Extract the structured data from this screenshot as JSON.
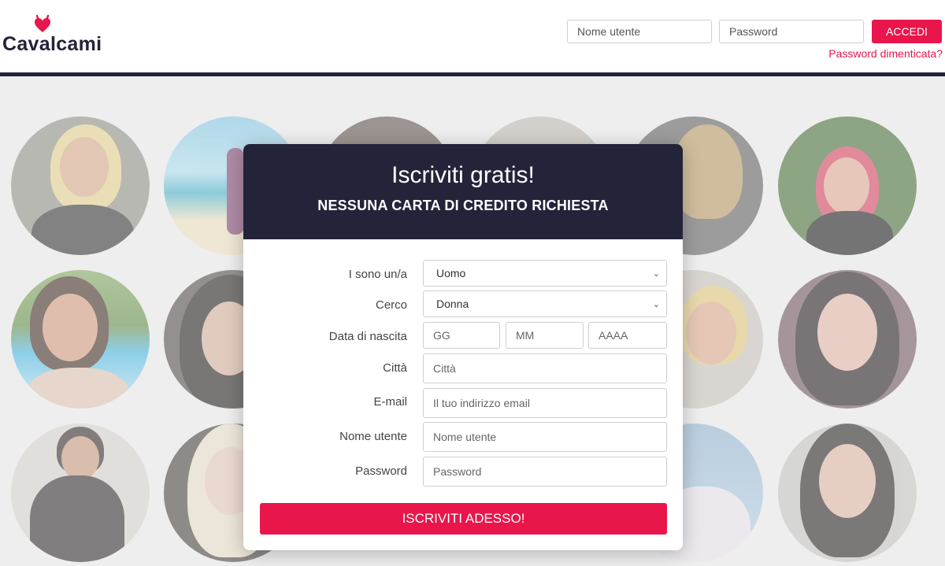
{
  "header": {
    "logo_text": "Cavalcami",
    "username_placeholder": "Nome utente",
    "password_placeholder": "Password",
    "login_label": "ACCEDI",
    "forgot_label": "Password dimenticata?"
  },
  "modal": {
    "title": "Iscriviti gratis!",
    "subtitle": "NESSUNA CARTA DI CREDITO RICHIESTA",
    "fields": {
      "i_am_label": "I sono un/a",
      "i_am_value": "Uomo",
      "seeking_label": "Cerco",
      "seeking_value": "Donna",
      "birthdate_label": "Data di nascita",
      "day_placeholder": "GG",
      "month_placeholder": "MM",
      "year_placeholder": "AAAA",
      "city_label": "Città",
      "city_placeholder": "Città",
      "email_label": "E-mail",
      "email_placeholder": "Il tuo indirizzo email",
      "username_label": "Nome utente",
      "username_placeholder": "Nome utente",
      "password_label": "Password",
      "password_placeholder": "Password"
    },
    "submit_label": "ISCRIVITI ADESSO!"
  },
  "colors": {
    "accent": "#e8164b",
    "navy": "#23233a",
    "background": "#eeeeee"
  }
}
